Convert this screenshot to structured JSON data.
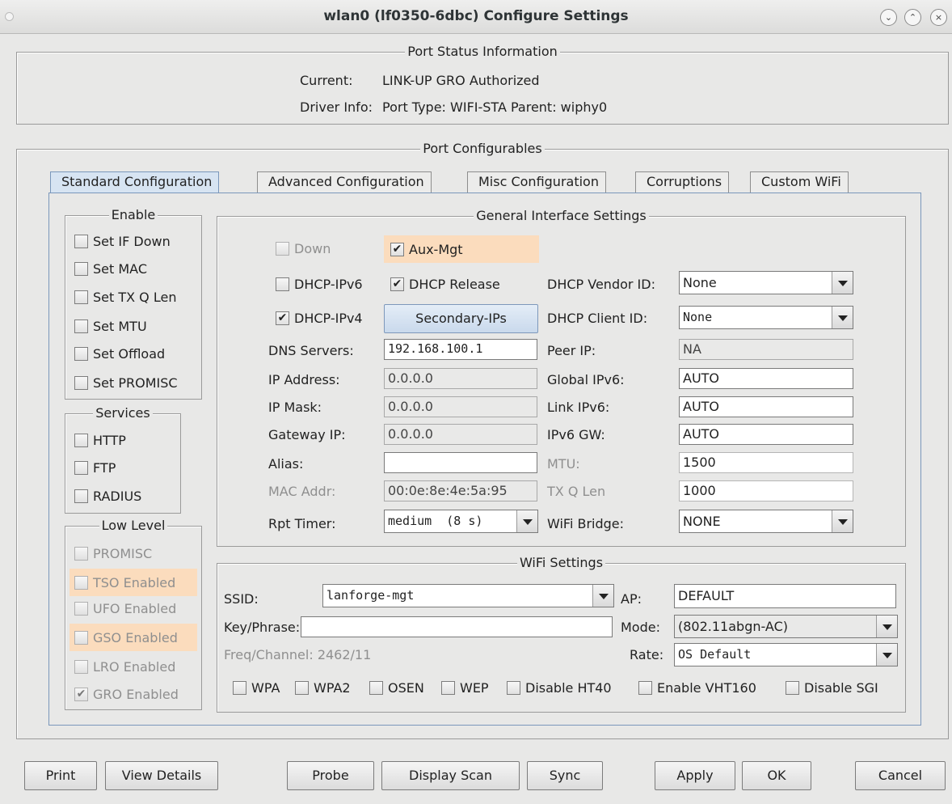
{
  "window": {
    "title": "wlan0  (lf0350-6dbc) Configure Settings"
  },
  "status": {
    "group_title": "Port Status Information",
    "current_label": "Current:",
    "current_value": "LINK-UP GRO  Authorized",
    "driver_label": "Driver Info:",
    "driver_value": "Port Type: WIFI-STA   Parent: wiphy0"
  },
  "config_title": "Port Configurables",
  "tabs": [
    "Standard Configuration",
    "Advanced Configuration",
    "Misc Configuration",
    "Corruptions",
    "Custom WiFi"
  ],
  "enable": {
    "title": "Enable",
    "items": [
      "Set IF Down",
      "Set MAC",
      "Set TX Q Len",
      "Set MTU",
      "Set Offload",
      "Set PROMISC"
    ]
  },
  "services": {
    "title": "Services",
    "items": [
      "HTTP",
      "FTP",
      "RADIUS"
    ]
  },
  "low_level": {
    "title": "Low Level",
    "items": [
      "PROMISC",
      "TSO Enabled",
      "UFO Enabled",
      "GSO Enabled",
      "LRO Enabled",
      "GRO Enabled"
    ]
  },
  "general": {
    "title": "General Interface Settings",
    "down": "Down",
    "aux_mgt": "Aux-Mgt",
    "dhcp_ipv6": "DHCP-IPv6",
    "dhcp_release": "DHCP Release",
    "dhcp_ipv4": "DHCP-IPv4",
    "secondary_ips": "Secondary-IPs",
    "dhcp_vendor_label": "DHCP Vendor ID:",
    "dhcp_vendor_value": "None",
    "dhcp_client_label": "DHCP Client ID:",
    "dhcp_client_value": "None",
    "dns_label": "DNS Servers:",
    "dns_value": "192.168.100.1",
    "peer_ip_label": "Peer IP:",
    "peer_ip_value": "NA",
    "ip_addr_label": "IP Address:",
    "ip_addr_value": "0.0.0.0",
    "global_ipv6_label": "Global IPv6:",
    "global_ipv6_value": "AUTO",
    "ip_mask_label": "IP Mask:",
    "ip_mask_value": "0.0.0.0",
    "link_ipv6_label": "Link IPv6:",
    "link_ipv6_value": "AUTO",
    "gateway_label": "Gateway IP:",
    "gateway_value": "0.0.0.0",
    "ipv6_gw_label": "IPv6 GW:",
    "ipv6_gw_value": "AUTO",
    "alias_label": "Alias:",
    "alias_value": "",
    "mtu_label": "MTU:",
    "mtu_value": "1500",
    "mac_label": "MAC Addr:",
    "mac_value": "00:0e:8e:4e:5a:95",
    "txq_label": "TX Q Len",
    "txq_value": "1000",
    "rpt_label": "Rpt Timer:",
    "rpt_value": "medium  (8 s)",
    "bridge_label": "WiFi Bridge:",
    "bridge_value": "NONE"
  },
  "wifi": {
    "title": "WiFi Settings",
    "ssid_label": "SSID:",
    "ssid_value": "lanforge-mgt",
    "ap_label": "AP:",
    "ap_value": "DEFAULT",
    "key_label": "Key/Phrase:",
    "key_value": "",
    "mode_label": "Mode:",
    "mode_value": "(802.11abgn-AC)",
    "freq_label": "Freq/Channel: 2462/11",
    "rate_label": "Rate:",
    "rate_value": "OS Default",
    "options": [
      "WPA",
      "WPA2",
      "OSEN",
      "WEP",
      "Disable HT40",
      "Enable VHT160",
      "Disable SGI"
    ]
  },
  "buttons": {
    "print": "Print",
    "view_details": "View Details",
    "probe": "Probe",
    "display_scan": "Display Scan",
    "sync": "Sync",
    "apply": "Apply",
    "ok": "OK",
    "cancel": "Cancel"
  }
}
